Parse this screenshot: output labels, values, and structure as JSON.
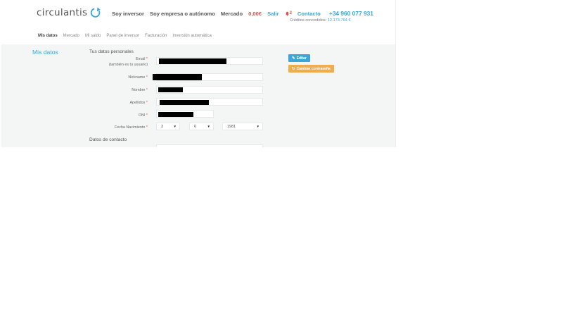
{
  "header": {
    "logo_text": "circulantis",
    "nav": {
      "inversor": "Soy inversor",
      "empresa": "Soy empresa o autónomo",
      "mercado": "Mercado",
      "balance": "0,00€",
      "salir": "Salir",
      "alerts_count": "2",
      "contacto": "Contacto",
      "phone": "+34 960 077 931"
    },
    "credits_label": "Créditos concedidos:",
    "credits_value": "12.173.764 €"
  },
  "subnav": [
    "Mis datos",
    "Mercado",
    "Mi saldo",
    "Panel de inversor",
    "Facturación",
    "Inversión automática"
  ],
  "main": {
    "side_title": "Mis datos",
    "personal_title": "Tus datos personales",
    "contact_title": "Datos de contacto",
    "labels": {
      "email": "Email",
      "email_note": "(también es tu usuario)",
      "nickname": "Nickname",
      "nombre": "Nombre",
      "apellidos": "Apellidos",
      "dni": "DNI",
      "fecha": "Fecha Nacimiento",
      "required_mark": "*"
    },
    "birth": {
      "day": "3",
      "month": "6",
      "year": "1981"
    },
    "buttons": {
      "edit": "Editar",
      "password": "Cambiar contraseña"
    }
  },
  "colors": {
    "accent": "#3aa6d9",
    "danger": "#d9534f",
    "warning": "#f0ad4e"
  }
}
